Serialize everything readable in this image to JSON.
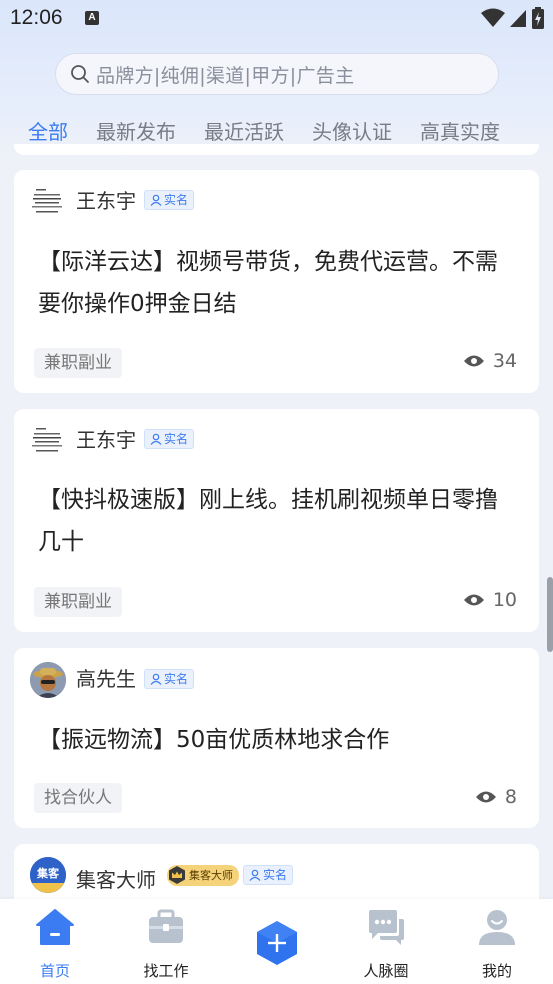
{
  "status_bar": {
    "time": "12:06",
    "notification_letter": "A"
  },
  "search": {
    "placeholder": "品牌方|纯佣|渠道|甲方|广告主"
  },
  "tabs": [
    {
      "label": "全部"
    },
    {
      "label": "最新发布"
    },
    {
      "label": "最近活跃"
    },
    {
      "label": "头像认证"
    },
    {
      "label": "高真实度"
    }
  ],
  "posts": [
    {
      "author": "王东宇",
      "badge": "实名",
      "title": "【际洋云达】视频号带货，免费代运营。不需要你操作0押金日结",
      "tag": "兼职副业",
      "views": "34"
    },
    {
      "author": "王东宇",
      "badge": "实名",
      "title": "【快抖极速版】刚上线。挂机刷视频单日零撸几十",
      "tag": "兼职副业",
      "views": "10"
    },
    {
      "author": "高先生",
      "badge": "实名",
      "title": "【振远物流】50亩优质林地求合作",
      "tag": "找合伙人",
      "views": "8"
    },
    {
      "author": "集客大师",
      "vip_badge": "集客大师",
      "badge": "实名",
      "avatar_text": "集客"
    }
  ],
  "nav": [
    {
      "label": "首页"
    },
    {
      "label": "找工作"
    },
    {
      "label": "人脉圈"
    },
    {
      "label": "我的"
    }
  ],
  "colors": {
    "accent": "#3b7cf3",
    "background": "#eef1f8"
  },
  "icons": [
    "search-icon",
    "wifi-icon",
    "signal-icon",
    "battery-icon",
    "eye-icon",
    "person-icon",
    "home-icon",
    "briefcase-icon",
    "plus-icon",
    "chat-icon",
    "user-icon",
    "crown-icon"
  ]
}
